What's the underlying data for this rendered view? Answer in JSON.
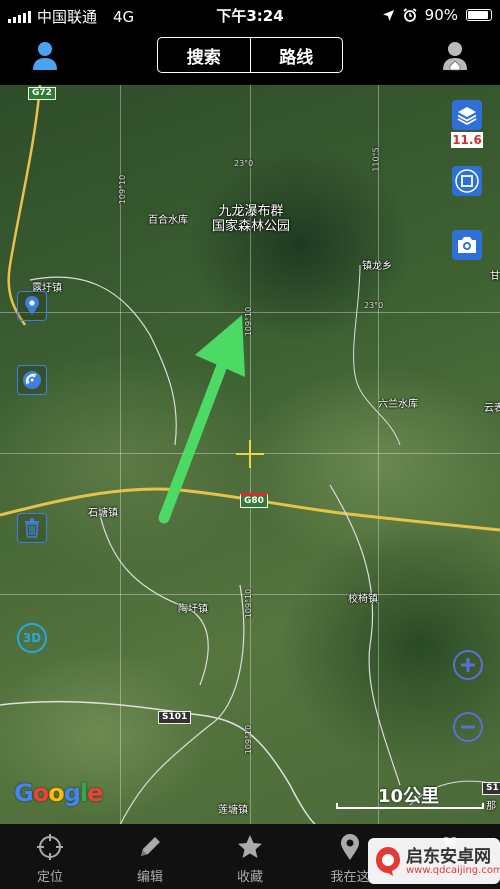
{
  "status_bar": {
    "carrier": "中国联通",
    "network": "4G",
    "time": "下午3:24",
    "battery_text": "90%",
    "battery_level": 0.9
  },
  "header": {
    "search_label": "搜索",
    "route_label": "路线"
  },
  "map": {
    "zoom_level": "11.6",
    "scale_label": "10公里",
    "attribution": "Google",
    "places": [
      {
        "id": "baihe-reservoir",
        "label": "百合水库"
      },
      {
        "id": "zhenlong",
        "label": "镇龙乡"
      },
      {
        "id": "luxu",
        "label": "露圩镇"
      },
      {
        "id": "liulan-reservoir",
        "label": "六兰水库"
      },
      {
        "id": "yun",
        "label": "云表"
      },
      {
        "id": "shitang",
        "label": "石塘镇"
      },
      {
        "id": "xiaomei",
        "label": "校椅镇"
      },
      {
        "id": "taoxu",
        "label": "陶圩镇"
      },
      {
        "id": "liantang",
        "label": "莲塘镇"
      },
      {
        "id": "edge-gan",
        "label": "甘"
      },
      {
        "id": "edge-na",
        "label": "那"
      }
    ],
    "park_name_line1": "九龙瀑布群",
    "park_name_line2": "国家森林公园",
    "road_badges": {
      "g72": "G72",
      "g80": "G80",
      "s101": "S101",
      "s101_b": "S1"
    },
    "grid_labels": {
      "lat1": "23°0",
      "lat2": "23°0",
      "lon1": "109°10",
      "lon2": "109°10",
      "lon3": "109°10",
      "lon4": "109°10",
      "lon_tr": "110°5"
    }
  },
  "tabbar": {
    "items": [
      {
        "label": "定位",
        "icon": "crosshair-icon"
      },
      {
        "label": "编辑",
        "icon": "pencil-icon"
      },
      {
        "label": "收藏",
        "icon": "star-icon"
      },
      {
        "label": "我在这",
        "icon": "pin-icon"
      },
      {
        "label": "",
        "icon": "more-icon"
      }
    ]
  },
  "watermark": {
    "name": "启东安卓网",
    "url": "www.qdcaijing.com"
  },
  "colors": {
    "accent_blue": "#2f6fd8",
    "zoom_text_red": "#d32f2f",
    "annotation_arrow": "#4cd964",
    "crosshair": "#e8d84a"
  }
}
